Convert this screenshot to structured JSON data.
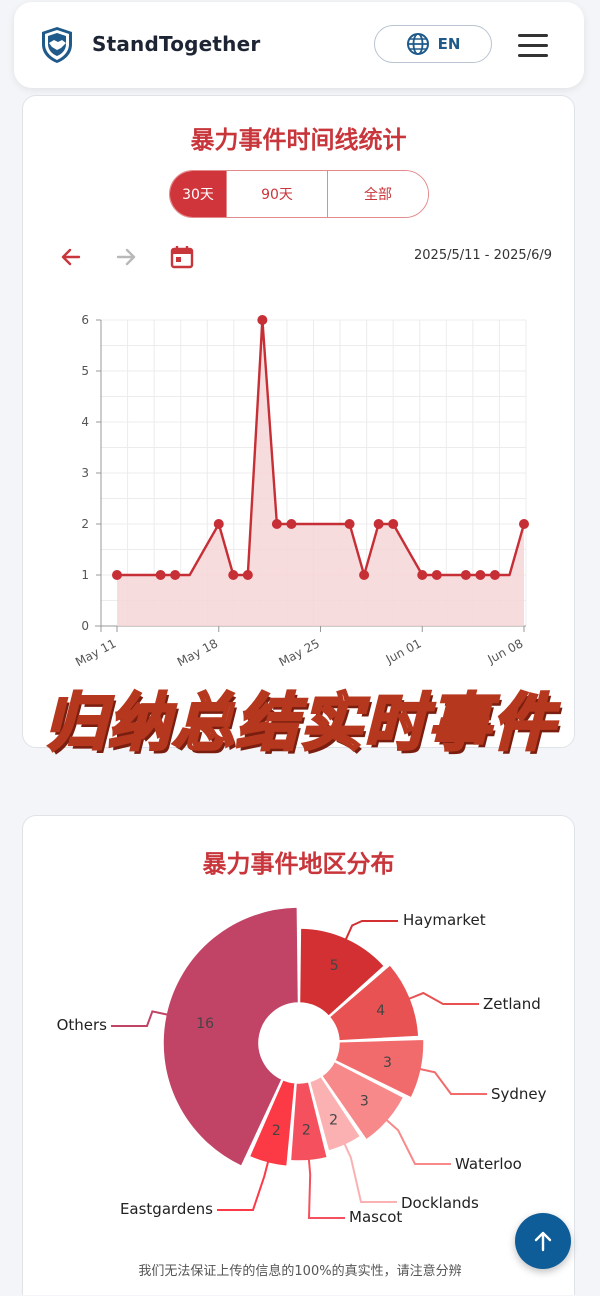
{
  "header": {
    "brand": "StandTogether",
    "language_label": "EN"
  },
  "timeline": {
    "title": "暴力事件时间线统计",
    "tabs": [
      "30天",
      "90天",
      "全部"
    ],
    "active_tab": 0,
    "date_range": "2025/5/11 - 2025/6/9"
  },
  "overlay_caption": "归纳总结实时事件",
  "chart_data": [
    {
      "type": "area",
      "x": [
        "2025-05-11",
        "2025-05-12",
        "2025-05-13",
        "2025-05-14",
        "2025-05-15",
        "2025-05-16",
        "2025-05-17",
        "2025-05-18",
        "2025-05-19",
        "2025-05-20",
        "2025-05-21",
        "2025-05-22",
        "2025-05-23",
        "2025-05-24",
        "2025-05-25",
        "2025-05-26",
        "2025-05-27",
        "2025-05-28",
        "2025-05-29",
        "2025-05-30",
        "2025-05-31",
        "2025-06-01",
        "2025-06-02",
        "2025-06-03",
        "2025-06-04",
        "2025-06-05",
        "2025-06-06",
        "2025-06-07",
        "2025-06-08"
      ],
      "values": [
        1,
        1,
        1,
        1,
        1,
        1,
        1.5,
        2,
        1,
        1,
        6,
        2,
        2,
        2,
        2,
        2,
        2,
        1,
        2,
        2,
        1.5,
        1,
        1,
        1,
        1,
        1,
        1,
        1,
        2
      ],
      "markers": [
        true,
        false,
        false,
        true,
        true,
        false,
        false,
        true,
        true,
        true,
        true,
        true,
        true,
        false,
        false,
        false,
        true,
        true,
        true,
        true,
        false,
        true,
        true,
        false,
        true,
        true,
        true,
        false,
        true
      ],
      "xticks": [
        "May 11",
        "May 18",
        "May 25",
        "Jun 01",
        "Jun 08"
      ],
      "yticks": [
        0,
        1,
        2,
        3,
        4,
        5,
        6
      ],
      "ylim": [
        0,
        6
      ],
      "color": "#c62f35",
      "fill": "#f6d6d8",
      "grid": true
    },
    {
      "type": "pie",
      "donut": true,
      "title": "暴力事件地区分布",
      "slices": [
        {
          "label": "Haymarket",
          "value": 5,
          "color": "#d23033"
        },
        {
          "label": "Zetland",
          "value": 4,
          "color": "#e85253"
        },
        {
          "label": "Sydney",
          "value": 3,
          "color": "#f26b6c"
        },
        {
          "label": "Waterloo",
          "value": 3,
          "color": "#f7898a"
        },
        {
          "label": "Docklands",
          "value": 2,
          "color": "#fbb1b1"
        },
        {
          "label": "Mascot",
          "value": 2,
          "color": "#f5505d"
        },
        {
          "label": "Eastgardens",
          "value": 2,
          "color": "#fc3a45"
        },
        {
          "label": "Others",
          "value": 16,
          "color": "#c14467"
        }
      ]
    }
  ],
  "disclaimer": "我们无法保证上传的信息的100%的真实性，请注意分辨",
  "colors": {
    "accent": "#d0353b",
    "fab": "#0e5d99",
    "brand_text": "#1d2433"
  }
}
